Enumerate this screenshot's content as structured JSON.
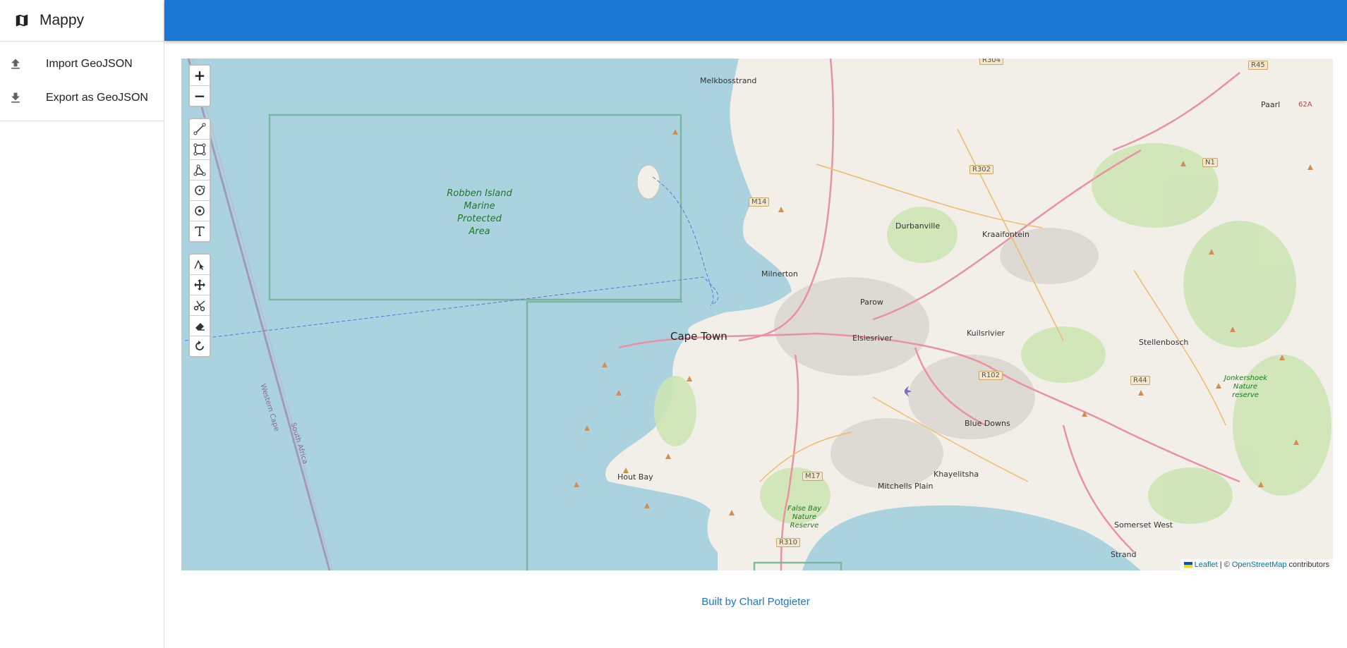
{
  "app": {
    "title": "Mappy"
  },
  "menu": [
    {
      "label": "Import GeoJSON",
      "icon": "upload-icon"
    },
    {
      "label": "Export as GeoJSON",
      "icon": "download-icon"
    }
  ],
  "map": {
    "zoom_in": "+",
    "zoom_out": "−",
    "draw_tools": [
      "polyline",
      "rectangle",
      "polygon",
      "circle",
      "circle-marker",
      "text"
    ],
    "edit_tools": [
      "edit",
      "drag",
      "cut",
      "remove",
      "rotate"
    ],
    "labels": {
      "robben": "Robben Island Marine Protected Area",
      "cape_town": "Cape Town",
      "melkbosstrand": "Melkbosstrand",
      "milnerton": "Milnerton",
      "parow": "Parow",
      "durbanville": "Durbanville",
      "kraaifontein": "Kraaifontein",
      "paarl": "Paarl",
      "elsiesriver": "Elsiesriver",
      "kuilsrivier": "Kuilsrivier",
      "stellenbosch": "Stellenbosch",
      "blue_downs": "Blue Downs",
      "khayelitsha": "Khayelitsha",
      "mitchells_plain": "Mitchells Plain",
      "hout_bay": "Hout Bay",
      "somerset_west": "Somerset West",
      "strand": "Strand",
      "jonkershoek": "Jonkershoek Nature reserve",
      "false_bay": "False Bay Nature Reserve",
      "western_cape": "Western Cape",
      "south_africa": "South Africa"
    },
    "shields": [
      "R304",
      "R45",
      "R302",
      "M14",
      "N1",
      "R102",
      "R44",
      "M17",
      "R310",
      "62A"
    ],
    "attribution": {
      "leaflet": "Leaflet",
      "sep": " | © ",
      "osm": "OpenStreetMap",
      "rest": " contributors"
    }
  },
  "footer": {
    "text": "Built by Charl Potgieter"
  },
  "colors": {
    "topbar": "#1976d2",
    "water": "#aad3df",
    "land": "#f2efe9"
  }
}
